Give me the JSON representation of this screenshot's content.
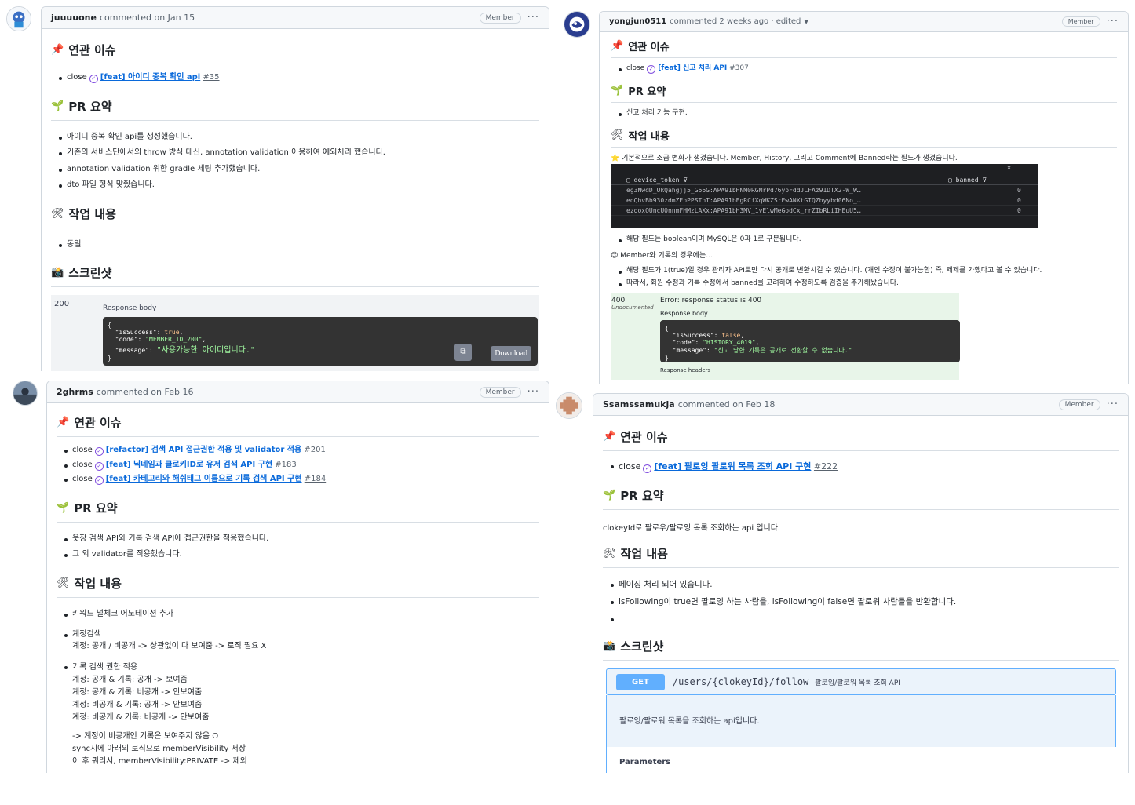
{
  "c1": {
    "user": "juuuuone",
    "meta": "commented on Jan 15",
    "badge": "Member",
    "h_issue": "연관 이슈",
    "close": "close",
    "issue_title": "[feat] 아이디 중복 확인 api",
    "issue_num": "#35",
    "h_summary": "PR 요약",
    "summary": [
      "아이디 중복 확인 api를 생성했습니다.",
      "기존의 서비스단에서의 throw 방식 대신, annotation validation 이용하여 예외처리 했습니다.",
      "annotation validation 위한 gradle 세팅 추가했습니다.",
      "dto 파일 형식 맞췄습니다."
    ],
    "h_work": "작업 내용",
    "work": [
      "동일"
    ],
    "h_shot": "스크린샷",
    "status": "200",
    "resp_label": "Response body",
    "json_l2k": "\"isSuccess\"",
    "json_l2v": "true",
    "json_l3k": "\"code\"",
    "json_l3v": "\"MEMBER_ID_200\"",
    "json_l4k": "\"message\"",
    "json_l4v": "\"사용가능한 아이디입니다.\"",
    "download": "Download"
  },
  "c2": {
    "user": "yongjun0511",
    "meta": "commented 2 weeks ago · edited",
    "badge": "Member",
    "h_issue": "연관 이슈",
    "close": "close",
    "issue_title": "[feat] 신고 처리 API",
    "issue_num": "#307",
    "h_summary": "PR 요약",
    "summary": [
      "신고 처리 기능 구현."
    ],
    "h_work": "작업 내용",
    "note1": "기본적으로 조금 변화가 생겼습니다. Member, History, 그리고 Comment에 Banned라는 필드가 생겼습니다.",
    "col1": "device_token",
    "col2": "banned",
    "rows": [
      [
        "eg3NwdD_UkQahgjj5_G66G:APA91bHNM0RGMrPd76ypFddJLFAz91DTX2-W_W…",
        "0"
      ],
      [
        "eoQhvBb930zdmZEpPPSTnT:APA91bEgRCfXqWKZSrEwANXtGIQZbyybd06No_…",
        "0"
      ],
      [
        "ezqoxOUncU0nnmFHMzLAXx:APA91bH3MV_1vElwMeGodCx_rrZIbRLiIHEuU5…",
        "0"
      ]
    ],
    "work1": [
      "해당 필드는 boolean이며 MySQL은 0과 1로 구분됩니다."
    ],
    "note2": "Member와 기록의 경우에는...",
    "work2": [
      "해당 필드가 1(true)일 경우 관리자 API로만 다시 공개로 변환시킬 수 있습니다. (개인 수정이 불가능함) 즉, 제제를 가했다고 볼 수 있습니다.",
      "따라서, 회원 수정과 기록 수정에서 banned를 고려하여 수정하도록 검증을 추가해놨습니다."
    ],
    "st": "400",
    "undoc": "Undocumented",
    "err": "Error: response status is 400",
    "resp_label": "Response body",
    "resp_headers": "Response headers",
    "j2k": "\"isSuccess\"",
    "j2v": "false",
    "j3k": "\"code\"",
    "j3v": "\"HISTORY_4019\"",
    "j4k": "\"message\"",
    "j4v": "\"신고 당한 기록은 공개로 전환할 수 없습니다.\""
  },
  "c3": {
    "user": "2ghrms",
    "meta": "commented on Feb 16",
    "badge": "Member",
    "h_issue": "연관 이슈",
    "issues": [
      {
        "title": "[refactor] 검색 API 접근권한 적용 및 validator 적용",
        "num": "#201"
      },
      {
        "title": "[feat] 닉네임과 클로키ID로 유저 검색 API 구현",
        "num": "#183"
      },
      {
        "title": "[feat] 카테고리와 해쉬태그 이름으로 기록 검색 API 구현",
        "num": "#184"
      }
    ],
    "close": "close",
    "h_summary": "PR 요약",
    "summary": [
      "옷장 검색 API와 기록 검색 API에 접근권한을 적용했습니다.",
      "그 외 validator를 적용했습니다."
    ],
    "h_work": "작업 내용",
    "w1": "키워드 널체크 어노테이션 추가",
    "w2": "계정검색",
    "w2a": "계정: 공개 / 비공개 -> 상관없이 다 보여줌 -> 로직 필요 X",
    "w3": "기록 검색 권한 적용",
    "w3a": "계정: 공개 & 기록: 공개 -> 보여줌",
    "w3b": "계정: 공개 & 기록: 비공개 -> 안보여줌",
    "w3c": "계정: 비공개 & 기록: 공개 -> 안보여줌",
    "w3d": "계정: 비공개 & 기록: 비공개 -> 안보여줌",
    "w4a": "-> 계정이 비공개인 기록은 보여주지 않음 O",
    "w4b": "sync시에 아래의 로직으로 memberVisibility 저장",
    "w4c": "이 후 쿼리시, memberVisibility:PRIVATE -> 제외"
  },
  "c4": {
    "user": "Ssamssamukja",
    "meta": "commented on Feb 18",
    "badge": "Member",
    "h_issue": "연관 이슈",
    "close": "close",
    "issue_title": "[feat] 팔로잉 팔로워 목록 조회 API 구현",
    "issue_num": "#222",
    "h_summary": "PR 요약",
    "summary_text": "clokeyId로 팔로우/팔로잉 목록 조회하는 api 입니다.",
    "h_work": "작업 내용",
    "work": [
      "페이징 처리 되어 있습니다.",
      "isFollowing이 true면 팔로잉 하는 사람을, isFollowing이 false면 팔로워 사람들을 반환합니다.",
      ""
    ],
    "h_shot": "스크린샷",
    "method": "GET",
    "path": "/users/{clokeyId}/follow",
    "path_desc": "팔로잉/팔로워 목록 조회 API",
    "desc": "팔로잉/팔로워 목록을 조회하는 api입니다.",
    "params": "Parameters"
  },
  "ui": {
    "dots": "···",
    "chevron": "▾",
    "filter": "⊽",
    "close_x": "✕",
    "copy": "⧉"
  },
  "icons": {
    "pin": "📌",
    "seedling": "🌱",
    "tools": "🛠",
    "camera": "📸",
    "star": "⭐",
    "smile": "😊",
    "calendar": "📅"
  },
  "colors": {
    "link": "#0969da",
    "border": "#d0d7de",
    "purple": "#8250df",
    "get": "#61affe",
    "green": "#49cc90"
  }
}
